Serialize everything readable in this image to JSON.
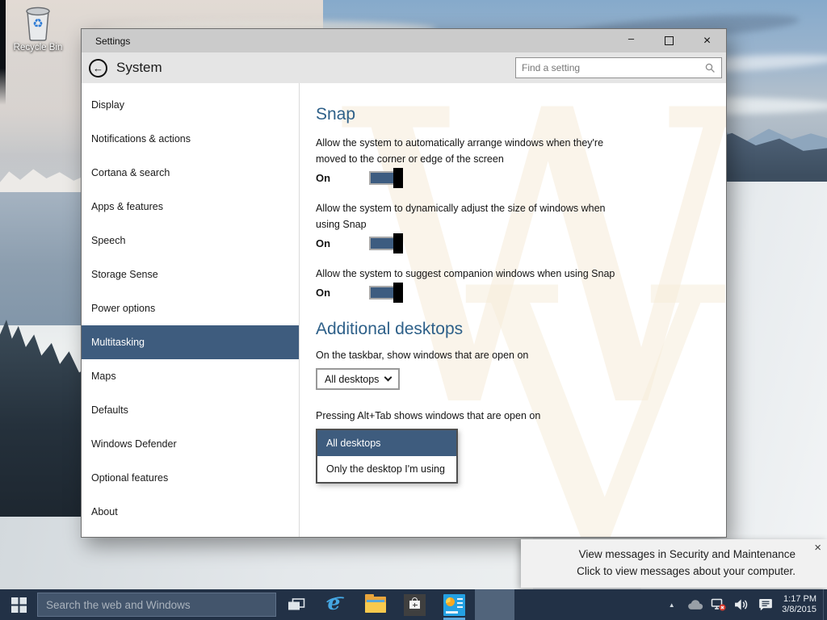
{
  "desktop": {
    "recycle_bin": {
      "label": "Recycle Bin"
    }
  },
  "window": {
    "title": "Settings",
    "controls": {
      "minimize": "–",
      "close": "×"
    },
    "header": {
      "back_glyph": "←",
      "page_title": "System",
      "search_placeholder": "Find a setting"
    },
    "sidebar": {
      "items": [
        {
          "label": "Display",
          "selected": false
        },
        {
          "label": "Notifications & actions",
          "selected": false
        },
        {
          "label": "Cortana & search",
          "selected": false
        },
        {
          "label": "Apps & features",
          "selected": false
        },
        {
          "label": "Speech",
          "selected": false
        },
        {
          "label": "Storage Sense",
          "selected": false
        },
        {
          "label": "Power options",
          "selected": false
        },
        {
          "label": "Multitasking",
          "selected": true
        },
        {
          "label": "Maps",
          "selected": false
        },
        {
          "label": "Defaults",
          "selected": false
        },
        {
          "label": "Windows Defender",
          "selected": false
        },
        {
          "label": "Optional features",
          "selected": false
        },
        {
          "label": "About",
          "selected": false
        }
      ]
    },
    "content": {
      "snap": {
        "heading": "Snap",
        "toggles": [
          {
            "text": "Allow the system to automatically arrange windows when they're moved to the corner or edge of the screen",
            "state": "On"
          },
          {
            "text": "Allow the system to dynamically adjust the size of windows when using Snap",
            "state": "On"
          },
          {
            "text": "Allow the system to suggest companion windows when using Snap",
            "state": "On"
          }
        ]
      },
      "additional_desktops": {
        "heading": "Additional desktops",
        "taskbar_question": "On the taskbar, show windows that are open on",
        "taskbar_dropdown_value": "All desktops",
        "alttab_question": "Pressing Alt+Tab shows windows that are open on",
        "alttab_options": [
          {
            "label": "All desktops",
            "selected": true
          },
          {
            "label": "Only the desktop I'm using",
            "selected": false
          }
        ]
      }
    }
  },
  "toast": {
    "line1": "View messages in Security and Maintenance",
    "line2": "Click to view messages about your computer.",
    "close": "×"
  },
  "taskbar": {
    "search_placeholder": "Search the web and Windows",
    "clock": {
      "time": "1:17 PM",
      "date": "3/8/2015"
    },
    "icons": {
      "ie_glyph": "e",
      "tray_expand_glyph": "▲",
      "recycle_glyph": "♻"
    }
  },
  "colors": {
    "accent": "#3e5c7e",
    "heading": "#2e6089",
    "taskbar": "#223146"
  },
  "decor": {
    "watermark_glyphs": [
      "W",
      "V"
    ]
  }
}
